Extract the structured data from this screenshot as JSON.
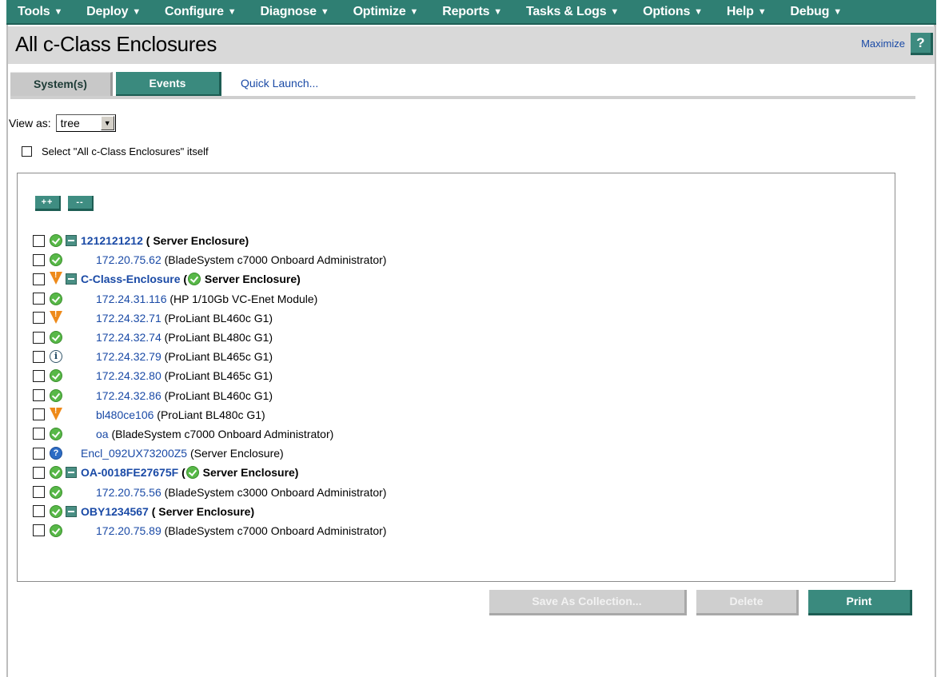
{
  "menubar": {
    "items": [
      "Tools",
      "Deploy",
      "Configure",
      "Diagnose",
      "Optimize",
      "Reports",
      "Tasks & Logs",
      "Options",
      "Help",
      "Debug"
    ]
  },
  "titlebar": {
    "title": "All c-Class Enclosures",
    "maximize_label": "Maximize",
    "help_label": "?"
  },
  "tabs": {
    "systems": "System(s)",
    "events": "Events",
    "quick_launch": "Quick Launch..."
  },
  "view_as": {
    "label": "View as:",
    "selected": "tree"
  },
  "select_all_label": "Select \"All c-Class Enclosures\" itself",
  "tree_buttons": {
    "expand_all": "++",
    "collapse_all": "--"
  },
  "tree": [
    {
      "status": "ok",
      "parent": true,
      "name": "1212121212",
      "desc": " ( Server Enclosure)"
    },
    {
      "status": "ok",
      "parent": false,
      "indent": "child",
      "name": "172.20.75.62",
      "desc": " (BladeSystem c7000 Onboard Administrator)"
    },
    {
      "status": "warning",
      "parent": true,
      "name": "C-Class-Enclosure",
      "desc_pre": " (",
      "desc_icon": "ok",
      "desc": " Server Enclosure)"
    },
    {
      "status": "ok",
      "parent": false,
      "indent": "child",
      "name": "172.24.31.116",
      "desc": " (HP 1/10Gb VC-Enet Module)"
    },
    {
      "status": "warning",
      "parent": false,
      "indent": "child",
      "name": "172.24.32.71",
      "desc": " (ProLiant BL460c G1)"
    },
    {
      "status": "ok",
      "parent": false,
      "indent": "child",
      "name": "172.24.32.74",
      "desc": " (ProLiant BL480c G1)"
    },
    {
      "status": "info",
      "parent": false,
      "indent": "child",
      "name": "172.24.32.79",
      "desc": " (ProLiant BL465c G1)"
    },
    {
      "status": "ok",
      "parent": false,
      "indent": "child",
      "name": "172.24.32.80",
      "desc": " (ProLiant BL465c G1)"
    },
    {
      "status": "ok",
      "parent": false,
      "indent": "child",
      "name": "172.24.32.86",
      "desc": " (ProLiant BL460c G1)"
    },
    {
      "status": "warning",
      "parent": false,
      "indent": "child",
      "name": "bl480ce106",
      "desc": " (ProLiant BL480c G1)"
    },
    {
      "status": "ok",
      "parent": false,
      "indent": "child",
      "name": "oa",
      "desc": " (BladeSystem c7000 Onboard Administrator)"
    },
    {
      "status": "unknown",
      "parent": false,
      "indent": "mid",
      "name": "Encl_092UX73200Z5",
      "desc": " (Server Enclosure)"
    },
    {
      "status": "ok",
      "parent": true,
      "name": "OA-0018FE27675F",
      "desc_pre": " (",
      "desc_icon": "ok",
      "desc": " Server Enclosure)"
    },
    {
      "status": "ok",
      "parent": false,
      "indent": "child",
      "name": "172.20.75.56",
      "desc": " (BladeSystem c3000 Onboard Administrator)"
    },
    {
      "status": "ok",
      "parent": true,
      "name": "OBY1234567",
      "desc": " ( Server Enclosure)"
    },
    {
      "status": "ok",
      "parent": false,
      "indent": "child",
      "name": "172.20.75.89",
      "desc": " (BladeSystem c7000 Onboard Administrator)"
    }
  ],
  "actions": {
    "save_as_collection": "Save As Collection...",
    "delete": "Delete",
    "print": "Print"
  }
}
